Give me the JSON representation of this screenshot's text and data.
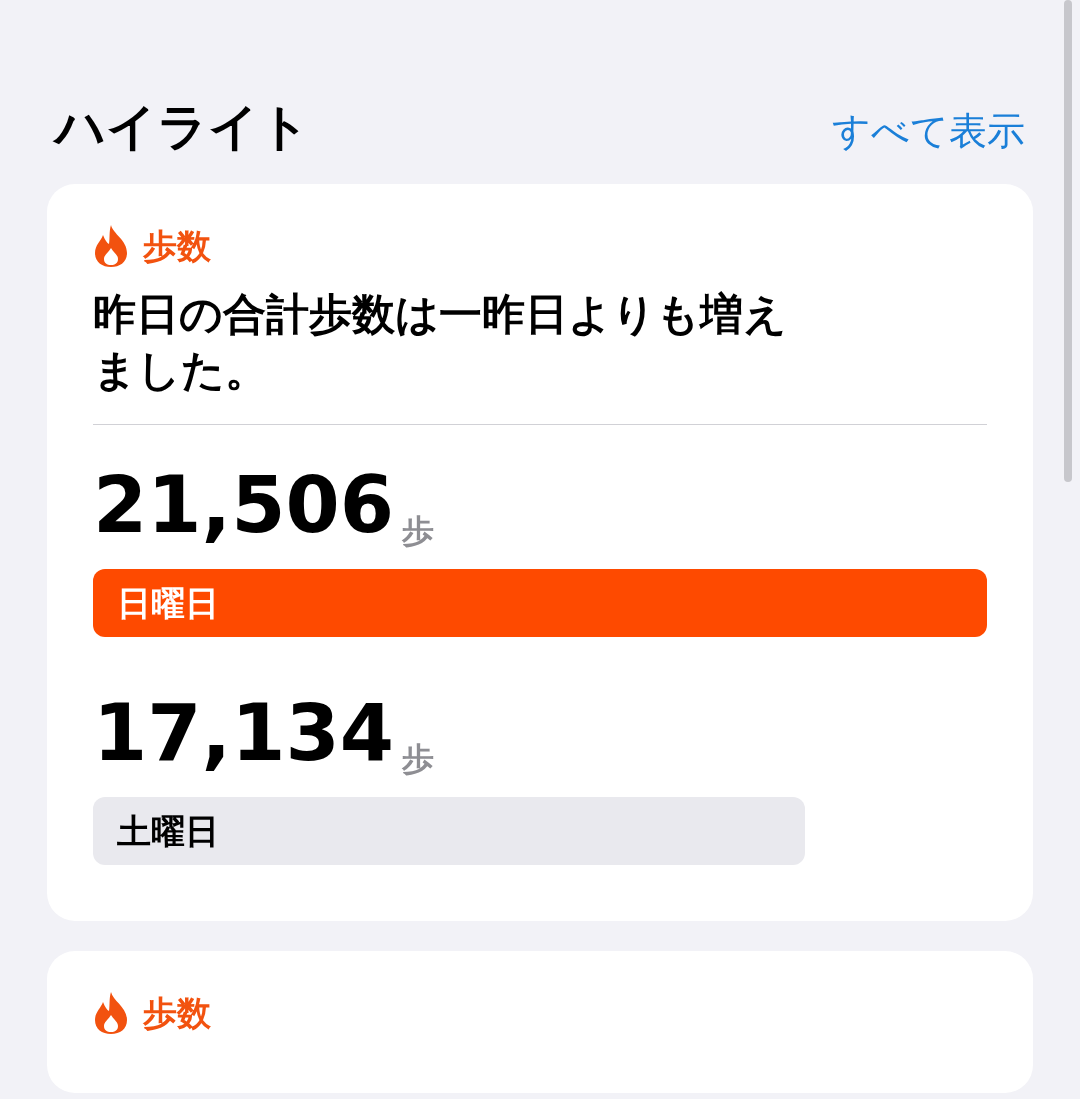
{
  "section": {
    "title": "ハイライト",
    "link": "すべて表示"
  },
  "cards": [
    {
      "category": "歩数",
      "summary": "昨日の合計歩数は一昨日よりも増えました。",
      "bars": [
        {
          "value": "21,506",
          "unit": "歩",
          "label": "日曜日",
          "highlighted": true
        },
        {
          "value": "17,134",
          "unit": "歩",
          "label": "土曜日",
          "highlighted": false
        }
      ]
    },
    {
      "category": "歩数"
    }
  ]
}
